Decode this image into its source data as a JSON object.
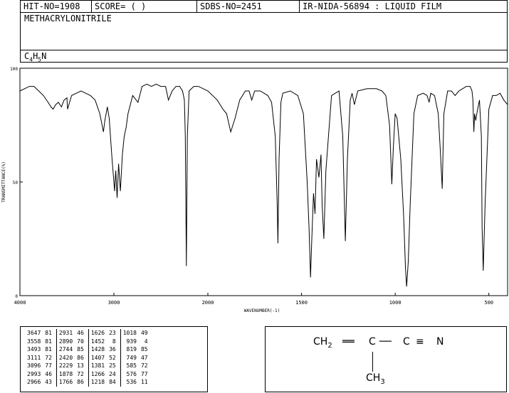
{
  "header": {
    "hit_no": "HIT-NO=1908",
    "score": "SCORE=  (  )",
    "sdbs_no": "SDBS-NO=2451",
    "ir_info": "IR-NIDA-56894 : LIQUID FILM",
    "compound_name": "METHACRYLONITRILE",
    "formula": {
      "c": "C",
      "c_n": "4",
      "h": "H",
      "h_n": "5",
      "n": "N"
    }
  },
  "structure": {
    "left": "CH",
    "left_sub": "2",
    "bond1": "══",
    "mid": "C",
    "bond2": "──",
    "right": "C",
    "bond3": "≡",
    "end": "N",
    "sub": "CH",
    "sub_n": "3"
  },
  "peak_table": [
    [
      [
        "3647",
        "81"
      ],
      [
        "2931",
        "46"
      ],
      [
        "1626",
        "23"
      ],
      [
        "1018",
        "49"
      ]
    ],
    [
      [
        "3558",
        "81"
      ],
      [
        "2890",
        "70"
      ],
      [
        "1452",
        "8"
      ],
      [
        "939",
        "4"
      ]
    ],
    [
      [
        "3493",
        "81"
      ],
      [
        "2744",
        "85"
      ],
      [
        "1428",
        "36"
      ],
      [
        "819",
        "85"
      ]
    ],
    [
      [
        "3111",
        "72"
      ],
      [
        "2420",
        "86"
      ],
      [
        "1407",
        "52"
      ],
      [
        "749",
        "47"
      ]
    ],
    [
      [
        "3096",
        "77"
      ],
      [
        "2229",
        "13"
      ],
      [
        "1381",
        "25"
      ],
      [
        "585",
        "72"
      ]
    ],
    [
      [
        "2993",
        "46"
      ],
      [
        "1878",
        "72"
      ],
      [
        "1266",
        "24"
      ],
      [
        "576",
        "77"
      ]
    ],
    [
      [
        "2966",
        "43"
      ],
      [
        "1766",
        "86"
      ],
      [
        "1218",
        "84"
      ],
      [
        "536",
        "11"
      ]
    ]
  ],
  "chart_data": {
    "type": "line",
    "xlabel": "WAVENUMBER(-1)",
    "ylabel": "TRANSMITTANCE(%)",
    "xlim": [
      4000,
      400
    ],
    "ylim": [
      0,
      100
    ],
    "x_ticks": [
      "4000",
      "3000",
      "2000",
      "1500",
      "1000",
      "500"
    ],
    "y_ticks": [
      "100",
      "50",
      "0"
    ],
    "series": [
      {
        "x": [
          4000,
          3950,
          3900,
          3850,
          3800,
          3750,
          3700,
          3670,
          3647,
          3620,
          3590,
          3558,
          3530,
          3500,
          3493,
          3450,
          3400,
          3350,
          3300,
          3250,
          3200,
          3150,
          3111,
          3096,
          3070,
          3050,
          3020,
          3000,
          2993,
          2980,
          2966,
          2950,
          2931,
          2910,
          2890,
          2870,
          2850,
          2800,
          2744,
          2700,
          2650,
          2600,
          2550,
          2500,
          2450,
          2420,
          2380,
          2340,
          2300,
          2270,
          2250,
          2240,
          2229,
          2218,
          2200,
          2150,
          2100,
          2050,
          2000,
          1950,
          1920,
          1900,
          1878,
          1855,
          1830,
          1800,
          1780,
          1766,
          1750,
          1720,
          1700,
          1680,
          1660,
          1640,
          1630,
          1626,
          1620,
          1610,
          1600,
          1560,
          1520,
          1490,
          1470,
          1460,
          1452,
          1445,
          1436,
          1428,
          1420,
          1407,
          1396,
          1390,
          1381,
          1370,
          1340,
          1300,
          1280,
          1266,
          1255,
          1240,
          1230,
          1218,
          1200,
          1150,
          1100,
          1070,
          1050,
          1030,
          1018,
          1010,
          1000,
          990,
          970,
          955,
          945,
          939,
          930,
          920,
          900,
          880,
          850,
          830,
          819,
          810,
          790,
          770,
          760,
          749,
          740,
          720,
          700,
          680,
          660,
          640,
          620,
          600,
          590,
          585,
          580,
          576,
          570,
          560,
          550,
          540,
          536,
          530,
          520,
          500,
          480,
          460,
          440,
          420,
          400
        ],
        "y": [
          90,
          91,
          92,
          92,
          90,
          88,
          85,
          83,
          82,
          84,
          85,
          83,
          86,
          87,
          82,
          88,
          89,
          90,
          89,
          88,
          86,
          80,
          72,
          77,
          83,
          78,
          60,
          50,
          46,
          55,
          43,
          58,
          46,
          62,
          70,
          74,
          80,
          88,
          85,
          92,
          93,
          92,
          93,
          92,
          92,
          86,
          90,
          92,
          92,
          90,
          86,
          70,
          13,
          70,
          90,
          92,
          92,
          91,
          90,
          86,
          82,
          80,
          72,
          78,
          86,
          90,
          90,
          86,
          90,
          90,
          89,
          88,
          85,
          70,
          40,
          23,
          60,
          85,
          89,
          90,
          88,
          80,
          50,
          30,
          8,
          25,
          45,
          36,
          60,
          52,
          62,
          40,
          25,
          55,
          88,
          90,
          70,
          24,
          60,
          86,
          89,
          84,
          90,
          91,
          91,
          90,
          88,
          75,
          49,
          65,
          80,
          78,
          60,
          35,
          12,
          4,
          15,
          40,
          80,
          88,
          89,
          88,
          85,
          89,
          88,
          80,
          65,
          47,
          80,
          90,
          90,
          88,
          90,
          91,
          92,
          92,
          90,
          86,
          72,
          80,
          77,
          82,
          86,
          70,
          30,
          11,
          40,
          82,
          88,
          88,
          89,
          86,
          84
        ]
      }
    ]
  }
}
